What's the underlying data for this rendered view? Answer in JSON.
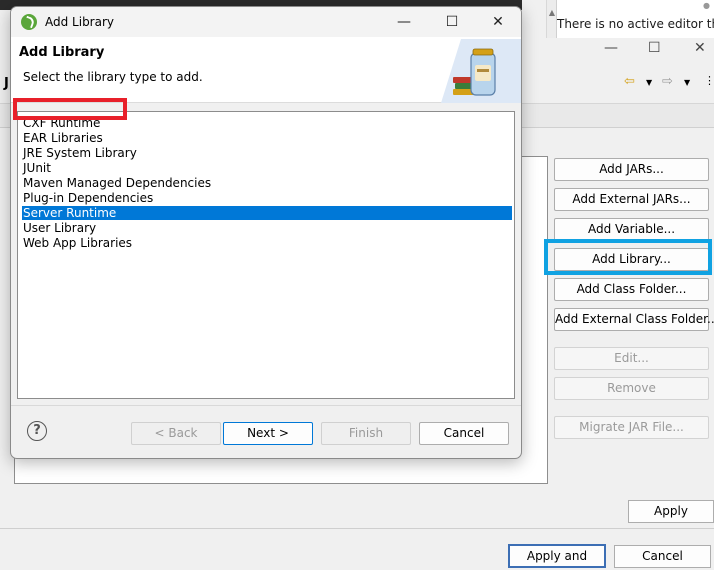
{
  "background": {
    "editor_message": "There is no active editor that",
    "window_letter": "J",
    "side_buttons": [
      {
        "label": "Add JARs...",
        "enabled": true
      },
      {
        "label": "Add External JARs...",
        "enabled": true
      },
      {
        "label": "Add Variable...",
        "enabled": true
      },
      {
        "label": "Add Library...",
        "enabled": true
      },
      {
        "label": "Add Class Folder...",
        "enabled": true
      },
      {
        "label": "Add External Class Folder...",
        "enabled": true
      },
      {
        "label": "Edit...",
        "enabled": false
      },
      {
        "label": "Remove",
        "enabled": false
      },
      {
        "label": "Migrate JAR File...",
        "enabled": false
      }
    ],
    "apply_label": "Apply",
    "apply_close_label": "Apply and Close",
    "cancel_label": "Cancel"
  },
  "dialog": {
    "title": "Add Library",
    "header_title": "Add Library",
    "header_subtitle": "Select the library type to add.",
    "library_types": [
      "CXF Runtime",
      "EAR Libraries",
      "JRE System Library",
      "JUnit",
      "Maven Managed Dependencies",
      "Plug-in Dependencies",
      "Server Runtime",
      "User Library",
      "Web App Libraries"
    ],
    "selected_index": 6,
    "help_glyph": "?",
    "buttons": {
      "back": "< Back",
      "next": "Next >",
      "finish": "Finish",
      "cancel": "Cancel"
    }
  },
  "colors": {
    "selection": "#0078d7",
    "highlight_red": "#e8202a",
    "highlight_blue": "#10a2e2"
  }
}
